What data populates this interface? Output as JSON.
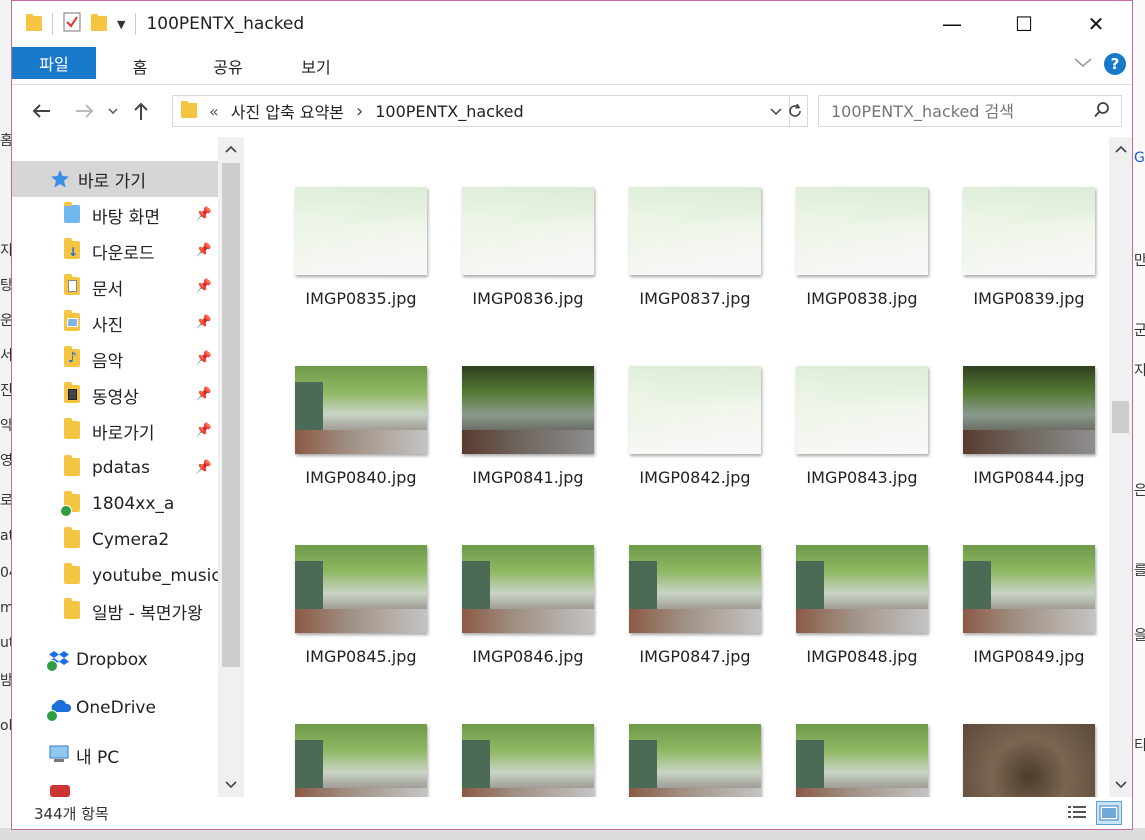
{
  "window": {
    "title": "100PENTX_hacked",
    "controls": {
      "minimize": "—",
      "maximize": "☐",
      "close": "✕"
    }
  },
  "ribbon": {
    "tabs": [
      "파일",
      "홈",
      "공유",
      "보기"
    ],
    "help": "?"
  },
  "address": {
    "crumb_prefix": "«",
    "crumbs": [
      "사진 압축 요약본",
      "100PENTX_hacked"
    ],
    "separator": "›"
  },
  "search": {
    "placeholder": "100PENTX_hacked 검색"
  },
  "nav": {
    "quick_access": "바로 가기",
    "items": [
      {
        "label": "바탕 화면",
        "pinned": true
      },
      {
        "label": "다운로드",
        "pinned": true
      },
      {
        "label": "문서",
        "pinned": true
      },
      {
        "label": "사진",
        "pinned": true
      },
      {
        "label": "음악",
        "pinned": true
      },
      {
        "label": "동영상",
        "pinned": true
      },
      {
        "label": "바로가기",
        "pinned": true
      },
      {
        "label": "pdatas",
        "pinned": true
      },
      {
        "label": "1804xx_a",
        "pinned": false
      },
      {
        "label": "Cymera2",
        "pinned": false
      },
      {
        "label": "youtube_music_",
        "pinned": false
      },
      {
        "label": "일밤 - 복면가왕",
        "pinned": false
      }
    ],
    "dropbox": "Dropbox",
    "onedrive": "OneDrive",
    "this_pc": "내 PC"
  },
  "files": [
    {
      "name": "IMGP0835.jpg",
      "tone": "bright"
    },
    {
      "name": "IMGP0836.jpg",
      "tone": "bright"
    },
    {
      "name": "IMGP0837.jpg",
      "tone": "bright"
    },
    {
      "name": "IMGP0838.jpg",
      "tone": "bright"
    },
    {
      "name": "IMGP0839.jpg",
      "tone": "bright"
    },
    {
      "name": "IMGP0840.jpg",
      "tone": "normal"
    },
    {
      "name": "IMGP0841.jpg",
      "tone": "dark"
    },
    {
      "name": "IMGP0842.jpg",
      "tone": "bright"
    },
    {
      "name": "IMGP0843.jpg",
      "tone": "bright"
    },
    {
      "name": "IMGP0844.jpg",
      "tone": "dark"
    },
    {
      "name": "IMGP0845.jpg",
      "tone": "normal"
    },
    {
      "name": "IMGP0846.jpg",
      "tone": "normal"
    },
    {
      "name": "IMGP0847.jpg",
      "tone": "normal"
    },
    {
      "name": "IMGP0848.jpg",
      "tone": "normal"
    },
    {
      "name": "IMGP0849.jpg",
      "tone": "normal"
    },
    {
      "name": "",
      "tone": "normal"
    },
    {
      "name": "",
      "tone": "normal"
    },
    {
      "name": "",
      "tone": "normal"
    },
    {
      "name": "",
      "tone": "normal"
    },
    {
      "name": "",
      "tone": "soil"
    }
  ],
  "status": {
    "count": "344개 항목"
  }
}
